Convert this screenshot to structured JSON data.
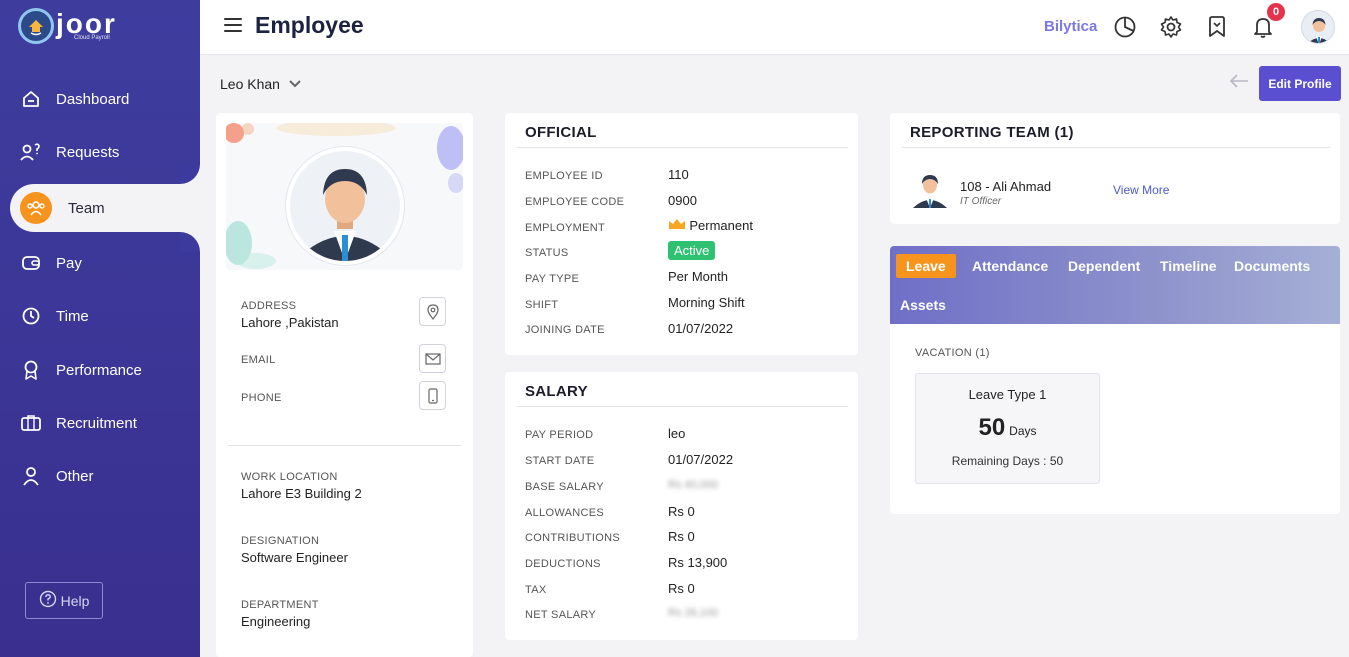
{
  "brand": {
    "name": "joor",
    "tagline": "Cloud Payroll"
  },
  "sidebar": {
    "items": [
      {
        "label": "Dashboard",
        "icon": "dashboard-icon"
      },
      {
        "label": "Requests",
        "icon": "requests-icon"
      },
      {
        "label": "Team",
        "icon": "team-icon",
        "active": true
      },
      {
        "label": "Pay",
        "icon": "pay-icon"
      },
      {
        "label": "Time",
        "icon": "clock-icon"
      },
      {
        "label": "Performance",
        "icon": "badge-icon"
      },
      {
        "label": "Recruitment",
        "icon": "briefcase-icon"
      },
      {
        "label": "Other",
        "icon": "user-icon"
      }
    ],
    "help_label": "Help"
  },
  "topbar": {
    "title": "Employee",
    "company": "Bilytica",
    "notification_count": "0"
  },
  "subheader": {
    "employee_name": "Leo Khan",
    "edit_profile_label": "Edit Profile"
  },
  "profile": {
    "address_label": "ADDRESS",
    "address_value": "Lahore ,Pakistan",
    "email_label": "EMAIL",
    "phone_label": "PHONE",
    "work_location_label": "WORK LOCATION",
    "work_location_value": "Lahore E3 Building 2",
    "designation_label": "DESIGNATION",
    "designation_value": "Software Engineer",
    "department_label": "DEPARTMENT",
    "department_value": "Engineering"
  },
  "official": {
    "title": "OFFICIAL",
    "rows": [
      {
        "label": "EMPLOYEE ID",
        "value": "110"
      },
      {
        "label": "EMPLOYEE CODE",
        "value": "0900"
      },
      {
        "label": "EMPLOYMENT",
        "value": "Permanent"
      },
      {
        "label": "STATUS",
        "value": "Active"
      },
      {
        "label": "PAY TYPE",
        "value": "Per Month"
      },
      {
        "label": "SHIFT",
        "value": "Morning Shift"
      },
      {
        "label": "JOINING DATE",
        "value": "01/07/2022"
      }
    ]
  },
  "salary": {
    "title": "SALARY",
    "rows": [
      {
        "label": "PAY PERIOD",
        "value": "leo"
      },
      {
        "label": "START DATE",
        "value": "01/07/2022"
      },
      {
        "label": "BASE SALARY",
        "value": "Rs 40,000"
      },
      {
        "label": "ALLOWANCES",
        "value": "Rs 0"
      },
      {
        "label": "CONTRIBUTIONS",
        "value": "Rs 0"
      },
      {
        "label": "DEDUCTIONS",
        "value": "Rs 13,900"
      },
      {
        "label": "TAX",
        "value": "Rs 0"
      },
      {
        "label": "NET SALARY",
        "value": "Rs 26,100"
      }
    ]
  },
  "reporting": {
    "title": "REPORTING TEAM (1)",
    "member_name": "108 - Ali Ahmad",
    "member_role": "IT Officer",
    "view_more": "View More"
  },
  "tabs": {
    "items": [
      "Leave",
      "Attendance",
      "Dependent",
      "Timeline",
      "Documents",
      "Assets"
    ],
    "active": "Leave"
  },
  "leave": {
    "section_label": "VACATION (1)",
    "type": "Leave Type 1",
    "days": "50",
    "days_unit": "Days",
    "remaining": "Remaining Days : 50"
  },
  "colors": {
    "sidebar": "#3e3d9e",
    "accent": "#f7941d",
    "primary_button": "#5b4fd1",
    "status_active": "#2fc172",
    "notification": "#e5334b"
  }
}
